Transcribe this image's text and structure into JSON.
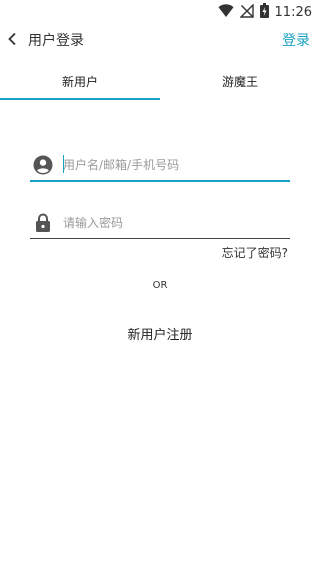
{
  "status_bar": {
    "time": "11:26",
    "icons": [
      "wifi-icon",
      "no-signal-icon",
      "battery-icon"
    ]
  },
  "app_bar": {
    "back_icon": "chevron-left-icon",
    "title": "用户登录",
    "action_label": "登录"
  },
  "tabs": [
    {
      "label": "新用户",
      "selected": true
    },
    {
      "label": "游魔王",
      "selected": false
    }
  ],
  "form": {
    "username": {
      "icon": "account-circle-icon",
      "placeholder": "用户名/邮箱/手机号码",
      "value": ""
    },
    "password": {
      "icon": "lock-icon",
      "placeholder": "请输入密码",
      "value": ""
    },
    "forgot_label": "忘记了密码?",
    "or_label": "OR",
    "register_label": "新用户注册"
  },
  "colors": {
    "accent": "#1ba1c2",
    "text": "#333333",
    "placeholder": "#9a9a9a",
    "icon": "#555555"
  }
}
